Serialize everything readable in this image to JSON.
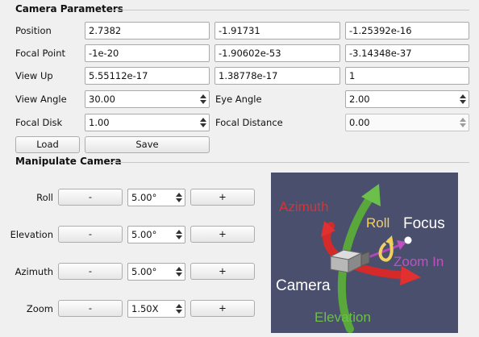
{
  "camera_parameters": {
    "title": "Camera Parameters",
    "position": {
      "label": "Position",
      "x": "2.7382",
      "y": "-1.91731",
      "z": "-1.25392e-16"
    },
    "focal_point": {
      "label": "Focal Point",
      "x": "-1e-20",
      "y": "-1.90602e-53",
      "z": "-3.14348e-37"
    },
    "view_up": {
      "label": "View Up",
      "x": "5.55112e-17",
      "y": "1.38778e-17",
      "z": "1"
    },
    "view_angle": {
      "label": "View Angle",
      "value": "30.00"
    },
    "eye_angle": {
      "label": "Eye Angle",
      "value": "2.00"
    },
    "focal_disk": {
      "label": "Focal Disk",
      "value": "1.00"
    },
    "focal_distance": {
      "label": "Focal Distance",
      "value": "0.00"
    },
    "load_label": "Load",
    "save_label": "Save"
  },
  "manipulate_camera": {
    "title": "Manipulate Camera",
    "rows": [
      {
        "label": "Roll",
        "minus": "-",
        "value": "5.00°",
        "plus": "+"
      },
      {
        "label": "Elevation",
        "minus": "-",
        "value": "5.00°",
        "plus": "+"
      },
      {
        "label": "Azimuth",
        "minus": "-",
        "value": "5.00°",
        "plus": "+"
      },
      {
        "label": "Zoom",
        "minus": "-",
        "value": "1.50X",
        "plus": "+"
      }
    ],
    "diagram": {
      "azimuth": "Azimuth",
      "roll": "Roll",
      "focus": "Focus",
      "zoom_in": "Zoom In",
      "camera": "Camera",
      "elevation": "Elevation",
      "colors": {
        "background": "#4a4f6e",
        "azimuth": "#e03030",
        "elevation": "#6bbf4a",
        "roll": "#f0d060",
        "zoom": "#c050c0",
        "text": "#ffffff"
      }
    }
  }
}
